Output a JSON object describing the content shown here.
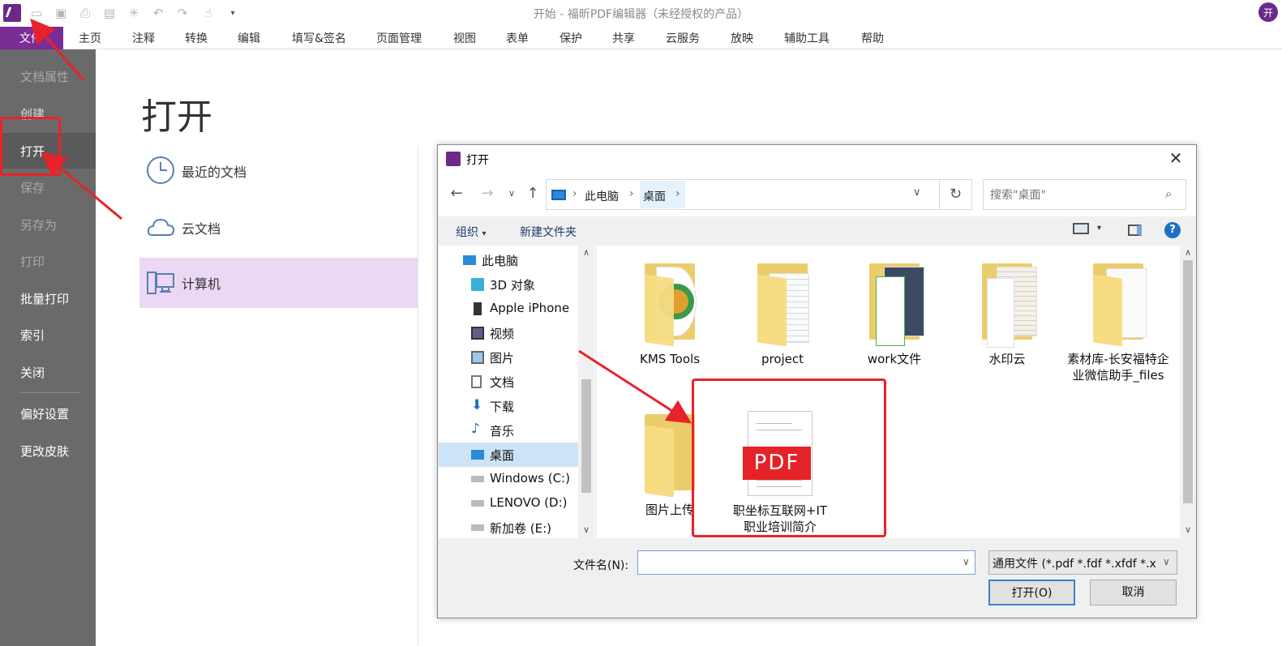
{
  "window": {
    "title": "开始 - 福昕PDF编辑器（未经授权的产品）",
    "user_initial": "开"
  },
  "menubar": {
    "items": [
      "文件",
      "主页",
      "注释",
      "转换",
      "编辑",
      "填写&签名",
      "页面管理",
      "视图",
      "表单",
      "保护",
      "共享",
      "云服务",
      "放映",
      "辅助工具",
      "帮助"
    ]
  },
  "sidebar": {
    "items": [
      "文档属性",
      "创建",
      "打开",
      "保存",
      "另存为",
      "打印",
      "批量打印",
      "索引",
      "关闭",
      "偏好设置",
      "更改皮肤"
    ]
  },
  "open_page": {
    "heading": "打开",
    "options": [
      "最近的文档",
      "云文档",
      "计算机"
    ]
  },
  "dialog": {
    "title": "打开",
    "breadcrumb": [
      "此电脑",
      "桌面"
    ],
    "search_placeholder": "搜索\"桌面\"",
    "toolbar": {
      "organize": "组织",
      "new_folder": "新建文件夹"
    },
    "nav_items": [
      "此电脑",
      "3D 对象",
      "Apple iPhone",
      "视频",
      "图片",
      "文档",
      "下载",
      "音乐",
      "桌面",
      "Windows (C:)",
      "LENOVO (D:)",
      "新加卷 (E:)"
    ],
    "files": [
      "KMS Tools",
      "project",
      "work文件",
      "水印云",
      "素材库-长安福特企业微信助手_files",
      "图片上传",
      "职坐标互联网+IT职业培训简介"
    ],
    "pdf_badge": "PDF",
    "filename_label": "文件名(N):",
    "filename_value": "",
    "filetype": "通用文件 (*.pdf *.fdf *.xfdf *.x",
    "open_button": "打开(O)",
    "cancel_button": "取消"
  },
  "colors": {
    "accent": "#7b2d96",
    "sidebar": "#6a6a6a",
    "annotation": "#e8222a",
    "selection": "#cce4f7"
  }
}
